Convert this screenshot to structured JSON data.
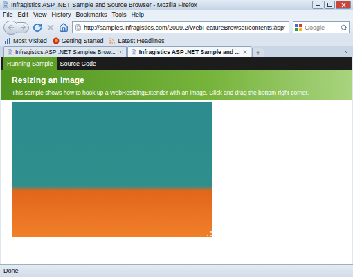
{
  "window": {
    "title": "Infragistics ASP .NET Sample and Source Browser - Mozilla Firefox"
  },
  "menu": [
    "File",
    "Edit",
    "View",
    "History",
    "Bookmarks",
    "Tools",
    "Help"
  ],
  "address_bar": {
    "url": "http://samples.infragistics.com/2009.2/WebFeatureBrowser/contents.asp"
  },
  "search": {
    "placeholder": "Google"
  },
  "bookmarks": [
    "Most Visited",
    "Getting Started",
    "Latest Headlines"
  ],
  "tabs": [
    {
      "label": "Infragistics ASP .NET Samples Brow...",
      "selected": false
    },
    {
      "label": "Infragistics ASP .NET Sample and ...",
      "selected": true
    }
  ],
  "page": {
    "tabs": [
      {
        "label": "Running Sample",
        "selected": true
      },
      {
        "label": "Source Code",
        "selected": false
      }
    ],
    "title": "Resizing an image",
    "description": "This sample shows how to hook up a WebResizingExtender with an image. Click and drag the bottom right corner."
  },
  "status_bar": {
    "text": "Done"
  }
}
